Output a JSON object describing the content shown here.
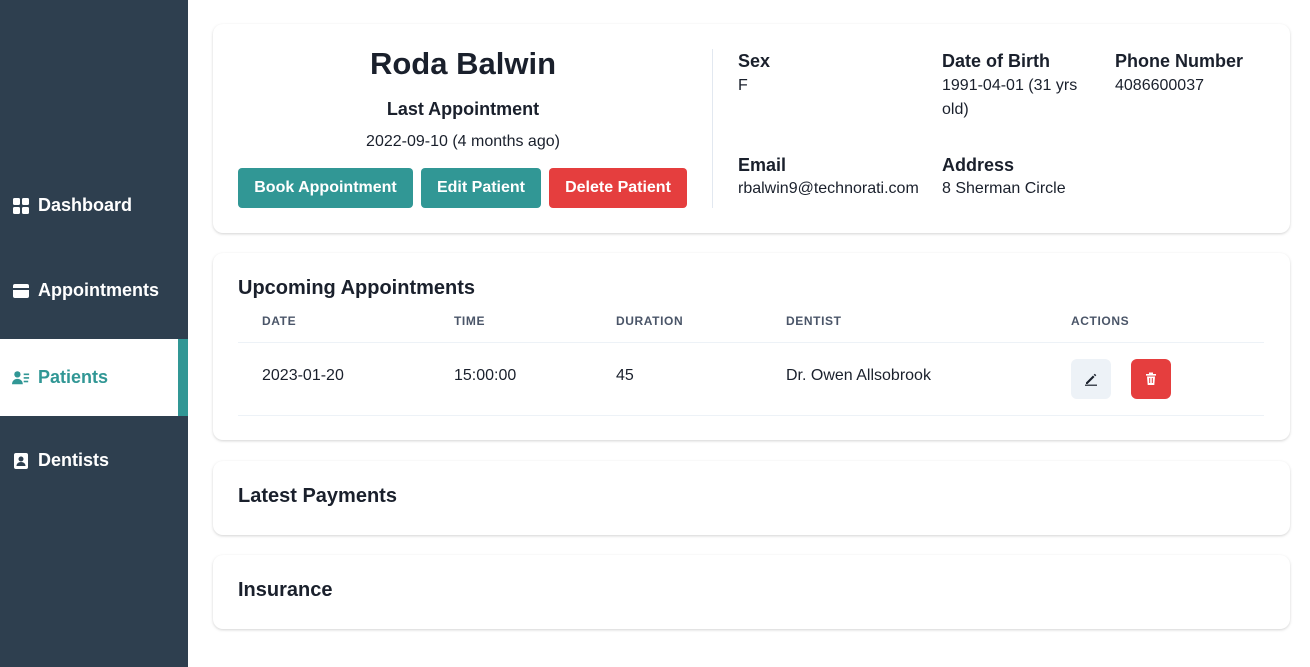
{
  "sidebar": {
    "items": [
      {
        "label": "Dashboard",
        "icon": "grid-icon",
        "active": false
      },
      {
        "label": "Appointments",
        "icon": "wallet-icon",
        "active": false
      },
      {
        "label": "Patients",
        "icon": "users-icon",
        "active": true
      },
      {
        "label": "Dentists",
        "icon": "id-badge-icon",
        "active": false
      }
    ]
  },
  "profile": {
    "name": "Roda Balwin",
    "last_appointment_label": "Last Appointment",
    "last_appointment_value": "2022-09-10 (4 months ago)",
    "buttons": {
      "book": "Book Appointment",
      "edit": "Edit Patient",
      "delete": "Delete Patient"
    },
    "fields": {
      "sex_label": "Sex",
      "sex_value": "F",
      "dob_label": "Date of Birth",
      "dob_value_line1": "1991-04-01 (31 yrs",
      "dob_value_line2": "old)",
      "phone_label": "Phone Number",
      "phone_value": "4086600037",
      "email_label": "Email",
      "email_value": "rbalwin9@technorati.com",
      "address_label": "Address",
      "address_value": "8 Sherman Circle"
    }
  },
  "upcoming": {
    "title": "Upcoming Appointments",
    "columns": [
      "DATE",
      "TIME",
      "DURATION",
      "DENTIST",
      "ACTIONS"
    ],
    "rows": [
      {
        "date": "2023-01-20",
        "time": "15:00:00",
        "duration": "45",
        "dentist": "Dr. Owen Allsobrook"
      }
    ]
  },
  "payments": {
    "title": "Latest Payments"
  },
  "insurance": {
    "title": "Insurance"
  },
  "colors": {
    "sidebar_bg": "#2e3f4f",
    "accent_teal": "#319795",
    "danger_red": "#e53e3e"
  }
}
